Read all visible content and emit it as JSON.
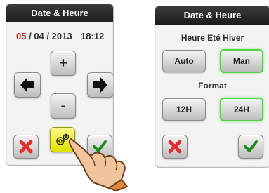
{
  "left_panel": {
    "title": "Date & Heure",
    "date": {
      "day": "05",
      "sep1": "/ 04 /",
      "year": "2013"
    },
    "time": "18:12",
    "buttons": {
      "plus": "+",
      "minus": "-"
    }
  },
  "right_panel": {
    "title": "Date & Heure",
    "dst_section": {
      "label": "Heure Eté Hiver",
      "auto_label": "Auto",
      "man_label": "Man",
      "selected": "Man"
    },
    "format_section": {
      "label": "Format",
      "h12_label": "12H",
      "h24_label": "24H",
      "selected": "24H"
    }
  },
  "colors": {
    "highlight_red": "#d01818",
    "selected_outline": "#55d24a",
    "cancel_icon": "#e03030",
    "confirm_icon": "#1f8a1f",
    "settings_button": "#e6e800"
  },
  "icons": [
    "left-arrow-icon",
    "right-arrow-icon",
    "close-icon",
    "checkmark-icon",
    "gear-icon",
    "pointing-hand-icon"
  ]
}
